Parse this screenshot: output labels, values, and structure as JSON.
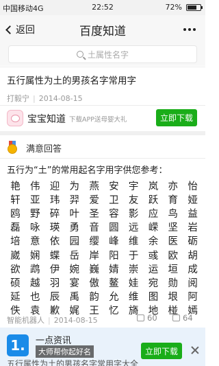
{
  "status_bar": {
    "carrier": "中国移动4G",
    "time": "22:52",
    "battery": "72%",
    "battery_level": 0.72
  },
  "nav": {
    "back_label": "返回",
    "title": "百度知道"
  },
  "search": {
    "placeholder": "土属性名字"
  },
  "question": {
    "title": "五行属性为土的男孩名字常用字",
    "author": "打毅宁",
    "date": "2014-08-15"
  },
  "app_banner": {
    "name": "宝宝知道",
    "slogan": "下载APP送母婴大礼",
    "button": "立即下载"
  },
  "answer": {
    "label": "满意回答",
    "intro": "五行为“土”的常用起名字用字供您参考：",
    "characters": [
      "艳",
      "伟",
      "迎",
      "为",
      "燕",
      "安",
      "宇",
      "岚",
      "亦",
      "怡",
      "轩",
      "亚",
      "玮",
      "羿",
      "爱",
      "卫",
      "友",
      "跃",
      "育",
      "娅",
      "鸥",
      "野",
      "碎",
      "叶",
      "圣",
      "容",
      "影",
      "应",
      "鸟",
      "益",
      "磊",
      "咏",
      "瑛",
      "勇",
      "音",
      "圆",
      "远",
      "嵘",
      "坚",
      "岩",
      "培",
      "意",
      "依",
      "园",
      "缨",
      "峰",
      "维",
      "余",
      "医",
      "砺",
      "崴",
      "娴",
      "蝶",
      "岳",
      "岸",
      "阳",
      "于",
      "彧",
      "欧",
      "胡",
      "欲",
      "鹉",
      "伊",
      "婉",
      "巍",
      "婧",
      "崇",
      "运",
      "垣",
      "成",
      "硕",
      "越",
      "羽",
      "宴",
      "傲",
      "鳌",
      "娃",
      "宛",
      "勋",
      "阅",
      "延",
      "也",
      "辰",
      "禹",
      "韵",
      "允",
      "维",
      "图",
      "垠",
      "阿",
      "佚",
      "袁",
      "歉",
      "娓",
      "王",
      "忆",
      "旖",
      "地",
      "椪",
      "嫣"
    ],
    "author": "智能机器人",
    "date": "2014-08-15",
    "likes": "60",
    "dislikes": "64"
  },
  "bottom_ad": {
    "logo": "1.",
    "title": "一点资讯",
    "subtitle": "大师帮你起好名",
    "behind_text": "五行属性为土的男孩名字常用字大全",
    "button": "立即下载"
  }
}
